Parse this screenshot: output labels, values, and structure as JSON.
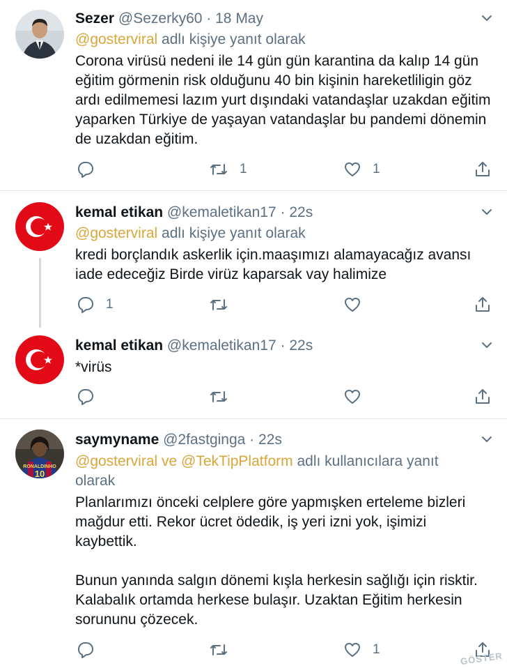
{
  "tweets": [
    {
      "name": "Sezer",
      "handle": "@Sezerky60",
      "sep": "·",
      "time": "18 May",
      "reply_mentions": "@gosterviral",
      "reply_suffix": " adlı kişiye yanıt olarak",
      "text": "Corona virüsü nedeni ile 14 gün gün karantina da kalıp 14 gün eğitim görmenin risk olduğunu 40 bin kişinin hareketliligin göz ardı edilmemesi lazım yurt dışındaki vatandaşlar uzakdan eğitim yaparken Türkiye de yaşayan vatandaşlar bu pandemi dönemin de  uzakdan eğitim.",
      "reply_count": "",
      "retweet_count": "1",
      "like_count": "1"
    },
    {
      "name": "kemal etikan",
      "handle": "@kemaletikan17",
      "sep": "·",
      "time": "22s",
      "reply_mentions": "@gosterviral",
      "reply_suffix": " adlı kişiye yanıt olarak",
      "text": "kredi borçlandık askerlik için.maaşımızı alamayacağız avansı iade edeceğiz Birde virüz kaparsak vay halimize",
      "reply_count": "1",
      "retweet_count": "",
      "like_count": ""
    },
    {
      "name": "kemal etikan",
      "handle": "@kemaletikan17",
      "sep": "·",
      "time": "22s",
      "text": "*virüs",
      "reply_count": "",
      "retweet_count": "",
      "like_count": ""
    },
    {
      "name": "saymyname",
      "handle": "@2fastginga",
      "sep": "·",
      "time": "22s",
      "reply_mentions": "@gosterviral ve @TekTipPlatform",
      "reply_suffix": " adlı kullanıcılara yanıt olarak",
      "text": "Planlarımızı önceki celplere göre yapmışken erteleme bizleri mağdur etti. Rekor ücret ödedik, iş yeri izni yok, işimizi kaybettik.\n\nBunun yanında salgın dönemi kışla herkesin sağlığı için risktir. Kalabalık ortamda herkese bulaşır. Uzaktan Eğitim herkesin sorununu çözecek.",
      "reply_count": "",
      "retweet_count": "",
      "like_count": "1"
    }
  ],
  "avatar_jersey_text": "RONALDINHO",
  "avatar_jersey_number": "10",
  "watermark": "GÖSTER",
  "colors": {
    "mention": "#d9a63a",
    "muted": "#5b7083",
    "divider": "#e1e8ed",
    "flag_red": "#e30a17"
  },
  "icons": [
    "reply-icon",
    "retweet-icon",
    "like-icon",
    "share-icon",
    "caret-down-icon"
  ]
}
